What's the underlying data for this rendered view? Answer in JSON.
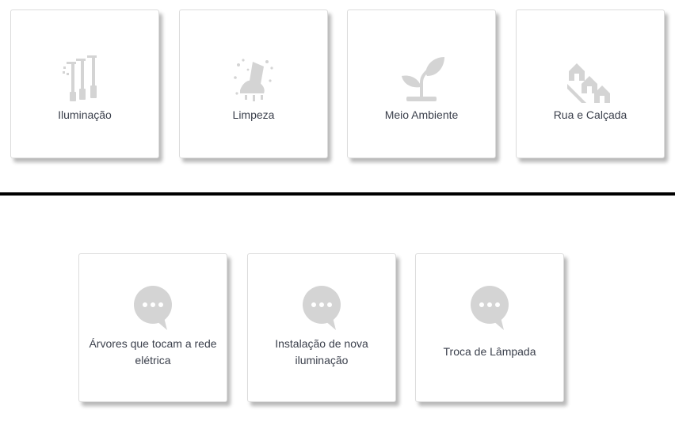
{
  "categories": [
    {
      "label": "Iluminação",
      "icon": "street-lights-icon"
    },
    {
      "label": "Limpeza",
      "icon": "cleaning-icon"
    },
    {
      "label": "Meio Ambiente",
      "icon": "plant-icon"
    },
    {
      "label": "Rua e Calçada",
      "icon": "street-houses-icon"
    }
  ],
  "services": [
    {
      "label": "Árvores que tocam a rede elétrica",
      "icon": "chat-bubble-icon"
    },
    {
      "label": "Instalação de nova iluminação",
      "icon": "chat-bubble-icon"
    },
    {
      "label": "Troca de Lâmpada",
      "icon": "chat-bubble-icon"
    }
  ],
  "colors": {
    "icon_gray": "#d4d4d4",
    "text": "#3a3f4b",
    "card_border": "#dcdcdc",
    "divider": "#000000"
  }
}
